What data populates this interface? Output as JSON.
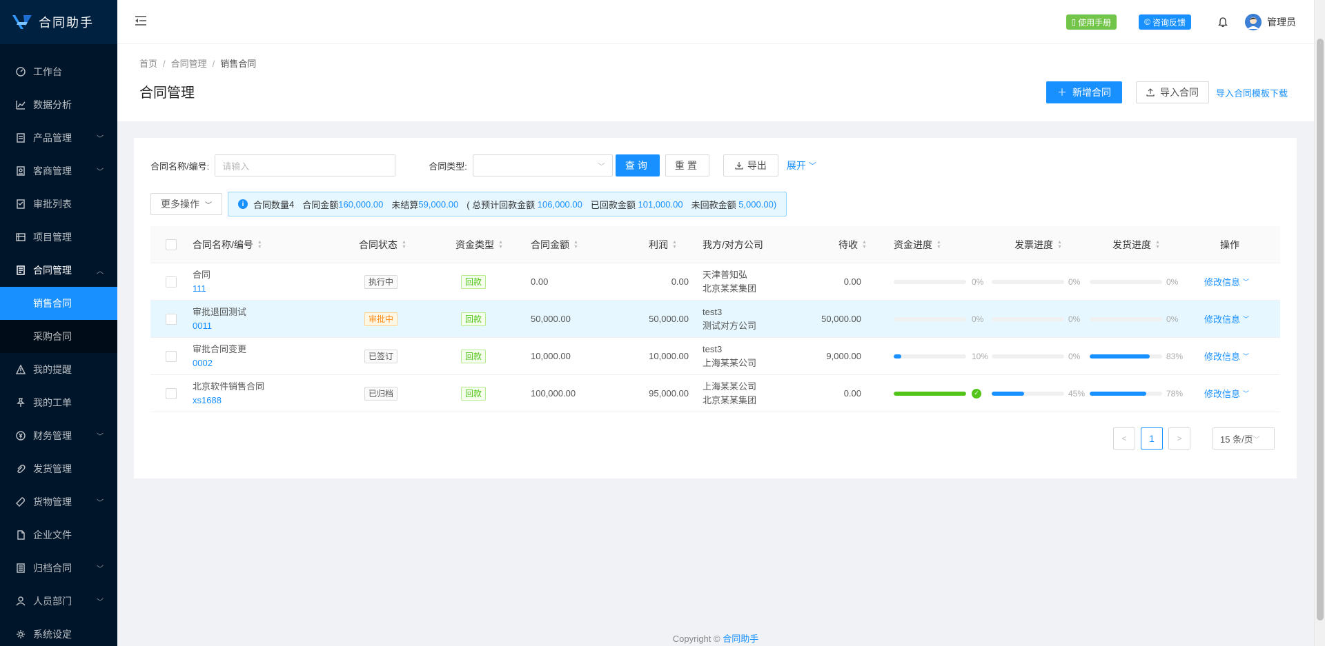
{
  "app": {
    "title": "合同助手",
    "brand_color": "#1890ff"
  },
  "sidebar": {
    "items": [
      {
        "label": "工作台",
        "icon": "dashboard-icon",
        "has_children": false
      },
      {
        "label": "数据分析",
        "icon": "line-chart-icon",
        "has_children": false
      },
      {
        "label": "产品管理",
        "icon": "product-icon",
        "has_children": true
      },
      {
        "label": "客商管理",
        "icon": "contacts-icon",
        "has_children": true
      },
      {
        "label": "审批列表",
        "icon": "audit-icon",
        "has_children": false
      },
      {
        "label": "项目管理",
        "icon": "project-icon",
        "has_children": false
      },
      {
        "label": "合同管理",
        "icon": "contract-icon",
        "has_children": true,
        "open": true,
        "children": [
          {
            "label": "销售合同",
            "active": true
          },
          {
            "label": "采购合同"
          }
        ]
      },
      {
        "label": "我的提醒",
        "icon": "warning-icon",
        "has_children": false
      },
      {
        "label": "我的工单",
        "icon": "pushpin-icon",
        "has_children": false
      },
      {
        "label": "财务管理",
        "icon": "money-icon",
        "has_children": true
      },
      {
        "label": "发货管理",
        "icon": "paperclip-icon",
        "has_children": false
      },
      {
        "label": "货物管理",
        "icon": "tool-icon",
        "has_children": true
      },
      {
        "label": "企业文件",
        "icon": "file-icon",
        "has_children": false
      },
      {
        "label": "归档合同",
        "icon": "archive-icon",
        "has_children": true
      },
      {
        "label": "人员部门",
        "icon": "user-icon",
        "has_children": true
      },
      {
        "label": "系统设定",
        "icon": "setting-icon",
        "has_children": false
      }
    ]
  },
  "header": {
    "manual_label": "使用手册",
    "feedback_label": "咨询反馈",
    "user_name": "管理员"
  },
  "page_header": {
    "breadcrumb": [
      "首页",
      "合同管理",
      "销售合同"
    ],
    "title": "合同管理",
    "new_button": "新增合同",
    "import_button": "导入合同",
    "template_link": "导入合同模板下载"
  },
  "filters": {
    "name_label": "合同名称/编号:",
    "name_placeholder": "请输入",
    "type_label": "合同类型:",
    "type_value": "",
    "query_button": "查询",
    "reset_button": "重置",
    "export_button": "导出",
    "expand_link": "展开"
  },
  "ops": {
    "more_button": "更多操作",
    "summary": {
      "count_label": "合同数量",
      "count": "4",
      "amount_label": "合同金额",
      "amount": "160,000.00",
      "unsettled_label": "未结算",
      "unsettled": "59,000.00",
      "expected_label": "( 总预计回款金额",
      "expected": "106,000.00",
      "received_label": "已回款金额",
      "received": "101,000.00",
      "unreceived_label": "未回款金额",
      "unreceived": "5,000.00)"
    }
  },
  "table": {
    "columns": [
      "合同名称/编号",
      "合同状态",
      "资金类型",
      "合同金额",
      "利润",
      "我方/对方公司",
      "待收",
      "资金进度",
      "发票进度",
      "发货进度",
      "操作"
    ],
    "rows": [
      {
        "name": "合同",
        "code": "111",
        "status": "执行中",
        "fund_type": "回款",
        "amount": "0.00",
        "profit": "0.00",
        "company_a": "天津普知弘",
        "company_b": "北京某某集团",
        "pending": "0.00",
        "fund_progress": 0,
        "fund_pct": "0%",
        "invoice_progress": 0,
        "invoice_pct": "0%",
        "ship_progress": 0,
        "ship_pct": "0%",
        "action": "修改信息"
      },
      {
        "name": "审批退回测试",
        "code": "0011",
        "status": "审批中",
        "fund_type": "回款",
        "amount": "50,000.00",
        "profit": "50,000.00",
        "company_a": "test3",
        "company_b": "测试对方公司",
        "pending": "50,000.00",
        "fund_progress": 0,
        "fund_pct": "0%",
        "invoice_progress": 0,
        "invoice_pct": "0%",
        "ship_progress": 0,
        "ship_pct": "0%",
        "action": "修改信息"
      },
      {
        "name": "审批合同变更",
        "code": "0002",
        "status": "已签订",
        "fund_type": "回款",
        "amount": "10,000.00",
        "profit": "10,000.00",
        "company_a": "test3",
        "company_b": "上海某某公司",
        "pending": "9,000.00",
        "fund_progress": 10,
        "fund_pct": "10%",
        "invoice_progress": 0,
        "invoice_pct": "0%",
        "ship_progress": 83,
        "ship_pct": "83%",
        "action": "修改信息"
      },
      {
        "name": "北京软件销售合同",
        "code": "xs1688",
        "status": "已归档",
        "fund_type": "回款",
        "amount": "100,000.00",
        "profit": "95,000.00",
        "company_a": "上海某某公司",
        "company_b": "北京某某集团",
        "pending": "0.00",
        "fund_progress": 100,
        "fund_pct": "",
        "invoice_progress": 45,
        "invoice_pct": "45%",
        "ship_progress": 78,
        "ship_pct": "78%",
        "action": "修改信息"
      }
    ]
  },
  "pagination": {
    "current": "1",
    "page_size": "15 条/页"
  },
  "footer": {
    "copyright": "Copyright",
    "brand": "合同助手"
  }
}
